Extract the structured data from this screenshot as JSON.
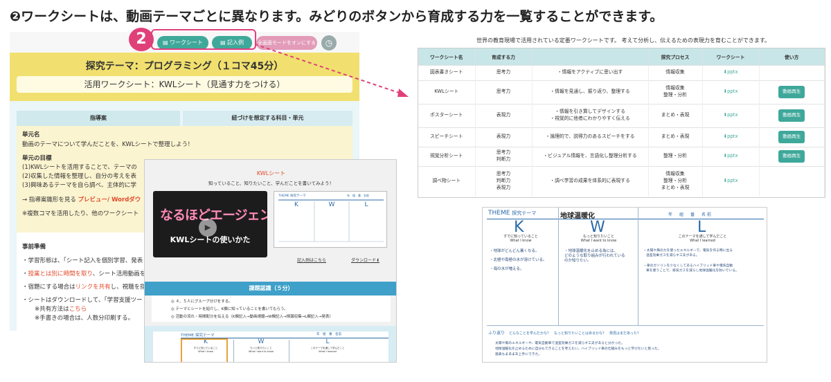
{
  "headline": "❷ワークシートは、動画テーマごとに異なります。みどりのボタンから育成する力を一覧することができます。",
  "badge_number": "2",
  "left_panel": {
    "btn_worksheet": "ワークシート",
    "btn_entry": "記入例",
    "btn_fullscreen": "全画面モードをオンにする",
    "theme_title": "探究テーマ：プログラミング（１コマ45分）",
    "sheet_title": "活用ワークシート：KWLシート（見通す力をつける）",
    "tab_guide": "指導案",
    "tab_subjects": "紐づけを想定する科目・単元",
    "unit_heading": "単元名",
    "unit_text": "動画のテーマについて学んだことを、KWLシートで整理しよう!",
    "goal_heading": "単元の目標",
    "goal_1": "(1)KWLシートを活用することで、テーマの",
    "goal_2": "(2)収集した情報を整理し、自分の考えを表",
    "goal_3": "(3)興味あるテーマを自ら調べ、主体的に学",
    "link_prefix": "→ 指導案雛形を見る",
    "link_preview": "プレビュー/ Wordダウ",
    "note_multi": "※複数コマを活用したり、他のワークシート",
    "prep_heading": "事前準備",
    "prep_1": "・学習形態は、「シート記入を個別学習、発表",
    "prep_2a": "・",
    "prep_2b": "授業とは別に時間を取り",
    "prep_2c": "、シート活用動画を",
    "prep_3a": "・宿題にする場合は",
    "prep_3b": "リンクを共有",
    "prep_3c": "し、視聴を指",
    "prep_4": "・シートはダウンロードして、「学習支援ツー",
    "prep_5a": "※共有方法は",
    "prep_5b": "こちら",
    "prep_6": "※手書きの場合は、人数分印刷する。"
  },
  "video_window": {
    "title": "KWLシート",
    "subtitle": "知っていること、知りたいこと、学んだことを書いてみよう！",
    "logo_text": "なるほどエージェント",
    "caption": "KWLシートの使いかた",
    "link_example": "記入例はこちら",
    "link_download": "ダウンロード⬇",
    "step_title": "課題認識（５分）",
    "step_1": "◎ ４、５人にグループ分けをする。",
    "step_2": "◎ テーマとシートを紹介し、K欄に知っていることを書いてもらう。",
    "step_3": "◎ 活動の流れ・時間配分を伝える（K欄記入→動画視聴→W欄記入→情報収集→L欄記入→発表）",
    "mini_theme": "THEME 探究テーマ",
    "mini_k": "K",
    "mini_w": "W",
    "mini_l": "L",
    "mini_k_sub": "すでに知っていること",
    "mini_w_sub": "もっと知りたいこと",
    "mini_l_sub": "このテーマを通して学んだこと",
    "mini_k_en": "What I know",
    "mini_w_en": "What I want to know",
    "mini_l_en": "What I learned",
    "mini_fields": "年　組　番　名前"
  },
  "right_table": {
    "caption": "世界の教育現場で活用されている定番ワークシートです。 考えて分析し、伝えるための表現力を育むことができます。",
    "headers": [
      "ワークシート名",
      "育成する力",
      "",
      "探究プロセス",
      "ワークシート",
      "使い方"
    ],
    "rows": [
      {
        "name": "図表書きシート",
        "power": "思考力",
        "desc": "・情報をアクティブに思い出す",
        "process": "情報収集",
        "file": "⬇pptx",
        "video": ""
      },
      {
        "name": "KWLシート",
        "power": "思考力",
        "desc": "・情報を見通し、振り返り、整理する",
        "process": "情報収集\n整理・分析",
        "file": "⬇pptx",
        "video": "動画再生"
      },
      {
        "name": "ポスターシート",
        "power": "表現力",
        "desc": "・情報を引き算してデザインする\n・視覚的に他者にわかりやすく伝える",
        "process": "まとめ・表現",
        "file": "⬇pptx",
        "video": "動画再生"
      },
      {
        "name": "スピーチシート",
        "power": "表現力",
        "desc": "・論理的で、説得力のあるスピーチをする",
        "process": "まとめ・表現",
        "file": "⬇pptx",
        "video": "動画再生"
      },
      {
        "name": "視覚分析シート",
        "power": "思考力\n判断力",
        "desc": "・ビジュアル情報を、言語化し整理分析する",
        "process": "整理・分析",
        "file": "⬇pptx",
        "video": "動画再生"
      },
      {
        "name": "調べ物シート",
        "power": "思考力\n判断力\n表現力",
        "desc": "・調べ学習の成果を体系的に表現する",
        "process": "情報収集\n整理・分析\nまとめ・表現",
        "file": "⬇pptx",
        "video": ""
      }
    ]
  },
  "kwl_sheet": {
    "theme_label": "THEME",
    "theme_label2": "探究テーマ",
    "theme_value": "地球温暖化",
    "fields": "年　組　番　名前",
    "k": "K",
    "w": "W",
    "l": "L",
    "k_sub": "すでに知っていること",
    "w_sub": "もっと知りたいこと",
    "l_sub": "このテーマを通して学んだこと",
    "k_en": "What I know",
    "w_en": "What I want to know",
    "l_en": "What I learned",
    "k_1": "・地球がどんどん暑くなる。",
    "k_2": "・北極や南極の氷が溶けている。",
    "k_3": "・海の水が増える。",
    "w_1": "・地球温暖化を止める為には、",
    "w_2": "どのような取り組みが行われている",
    "w_3": "のか知りたい。",
    "l_1": "・太陽や風の力を使ったエネルギーで、電気を作る時に出る",
    "l_2": "温室効果ガスを減らす工夫がある。",
    "l_3": "・車のガソリンを少なくしてあるハイブリッド車や電気自動",
    "l_4": "車を使うことで、排気ガスを減らし地球温暖化を防いでいる。",
    "reflect_label": "ふり返り",
    "reflect_prompt": "どんなことを学んだかな？　もっと知りたいことはあるかな？　発見はまだあった？",
    "reflect_1": "太陽や風のエネルギーや、電気自動車で温室効果ガスを減らす工夫があると分かった。",
    "reflect_2": "地球温暖化を止めるために自分もできることを考えたい。ハイブリッド車の仕組みをもっと学びたいと思った。",
    "reflect_3": "発表もまあまあ上手にできた。"
  }
}
